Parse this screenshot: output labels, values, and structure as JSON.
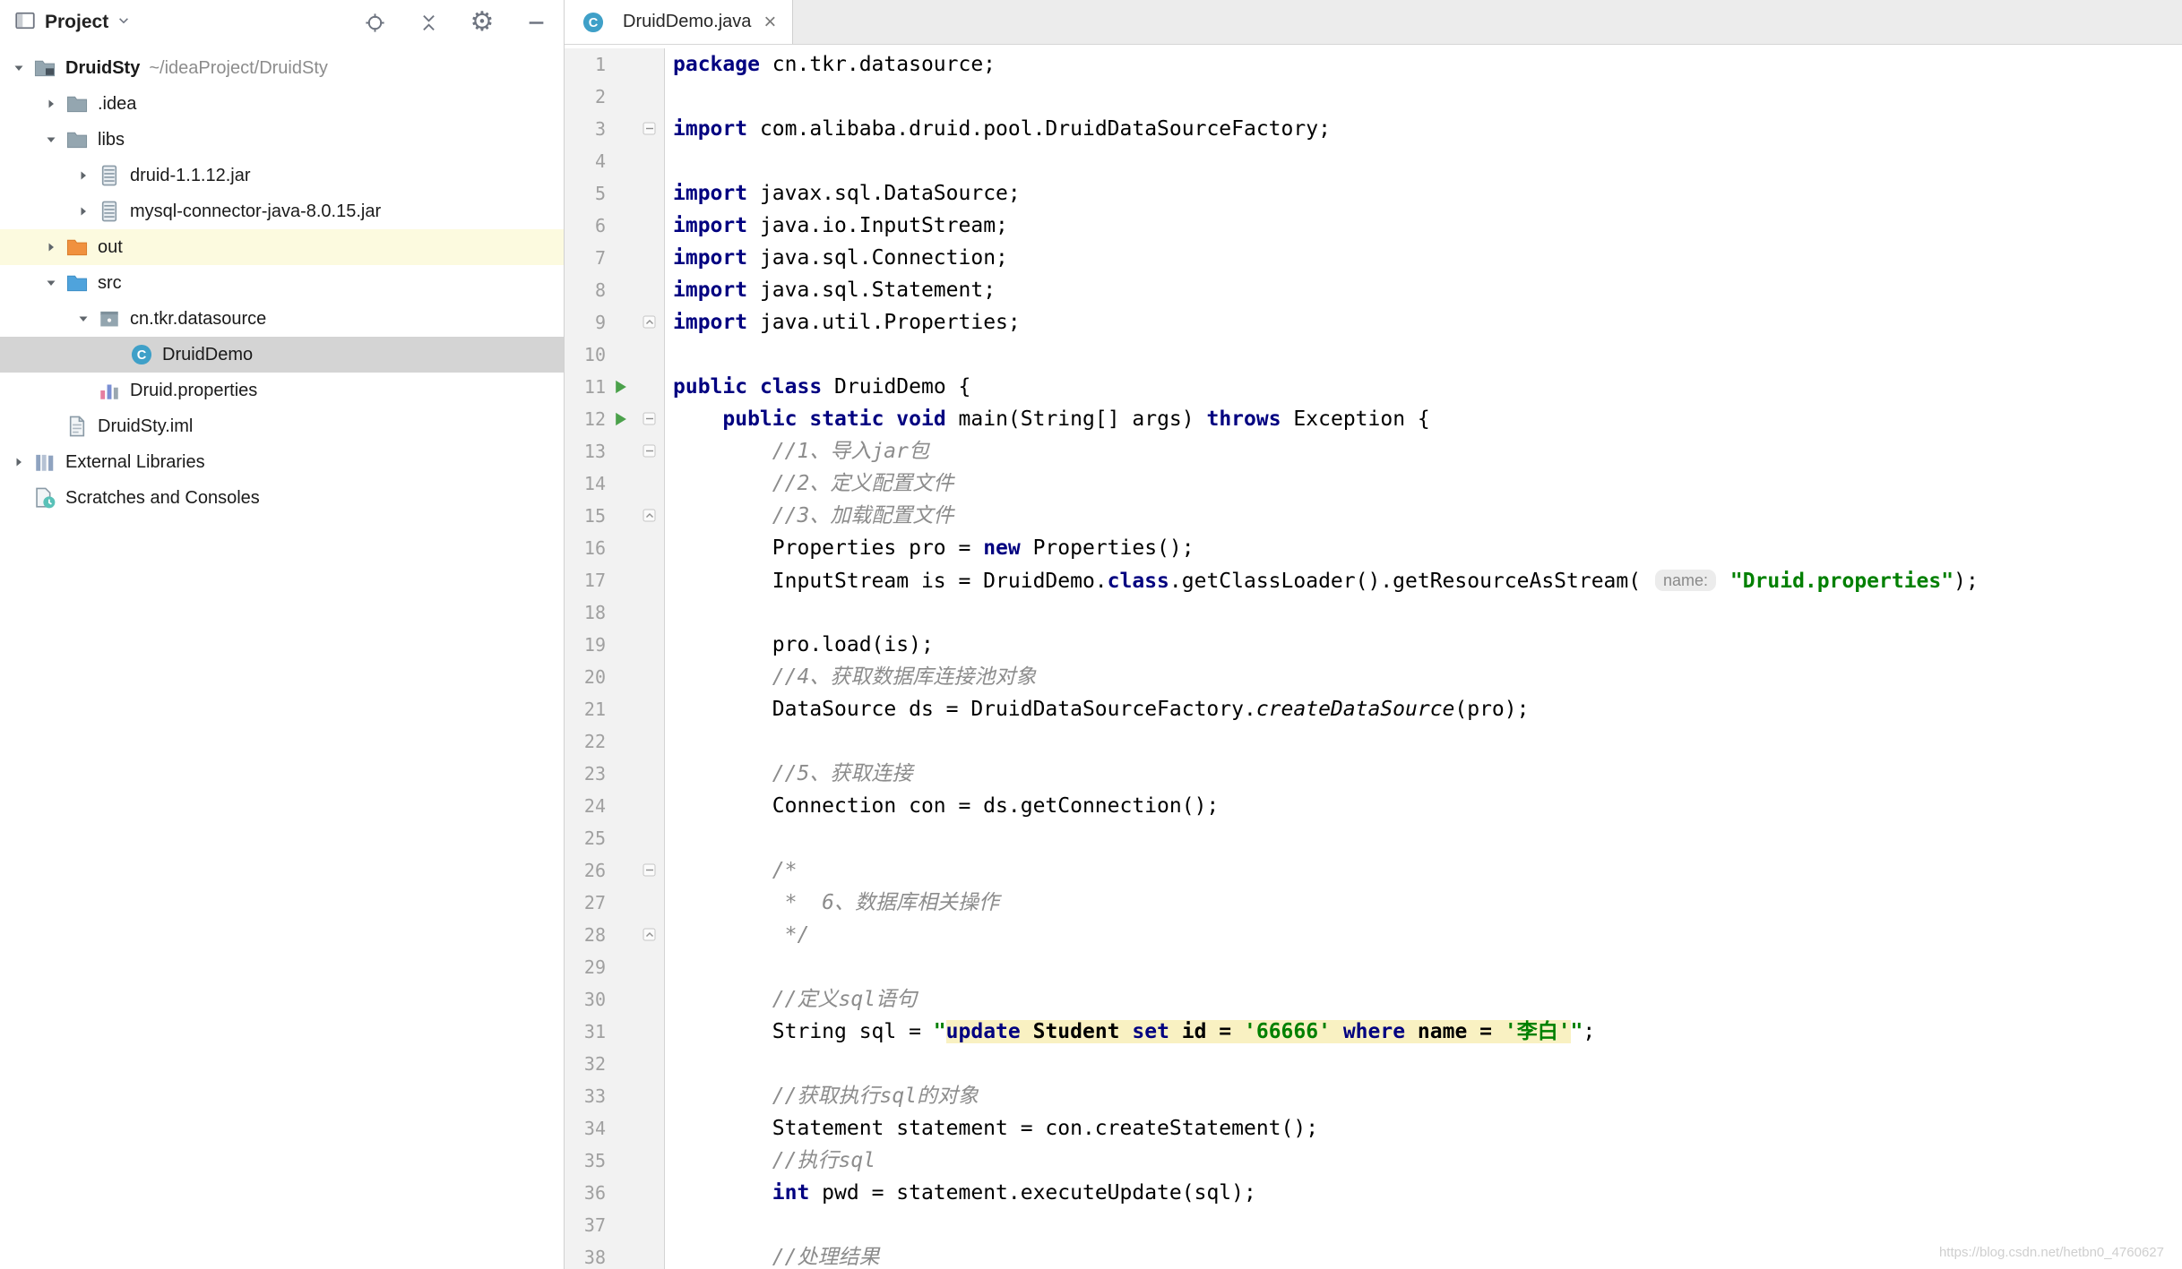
{
  "project_panel": {
    "toolbar": {
      "title": "Project",
      "actions": [
        "locate",
        "collapse-all",
        "settings",
        "hide-panel"
      ]
    },
    "tree": [
      {
        "depth": 0,
        "chevron": "down",
        "icon": "folder-project",
        "label": "DruidSty",
        "extra": "~/ideaProject/DruidSty",
        "bold": true
      },
      {
        "depth": 1,
        "chevron": "right",
        "icon": "folder",
        "label": ".idea"
      },
      {
        "depth": 1,
        "chevron": "down",
        "icon": "folder",
        "label": "libs"
      },
      {
        "depth": 2,
        "chevron": "right",
        "icon": "jar",
        "label": "druid-1.1.12.jar"
      },
      {
        "depth": 2,
        "chevron": "right",
        "icon": "jar",
        "label": "mysql-connector-java-8.0.15.jar"
      },
      {
        "depth": 1,
        "chevron": "right",
        "icon": "folder-excluded",
        "label": "out",
        "highlight": "yellow"
      },
      {
        "depth": 1,
        "chevron": "down",
        "icon": "folder-src",
        "label": "src"
      },
      {
        "depth": 2,
        "chevron": "down",
        "icon": "package",
        "label": "cn.tkr.datasource"
      },
      {
        "depth": 3,
        "chevron": "none",
        "icon": "class",
        "label": "DruidDemo",
        "selected": true
      },
      {
        "depth": 2,
        "chevron": "none",
        "icon": "properties",
        "label": "Druid.properties"
      },
      {
        "depth": 1,
        "chevron": "none",
        "icon": "file-iml",
        "label": "DruidSty.iml"
      },
      {
        "depth": 0,
        "chevron": "right",
        "icon": "libraries",
        "label": "External Libraries"
      },
      {
        "depth": 0,
        "chevron": "none",
        "icon": "scratches",
        "label": "Scratches and Consoles"
      }
    ]
  },
  "editor_tab": {
    "icon": "class",
    "label": "DruidDemo.java",
    "close_glyph": "×"
  },
  "editor": {
    "run_lines": [
      11,
      12
    ],
    "folds": {
      "3": "open",
      "9": "close",
      "12": "open",
      "13": "open",
      "15": "close",
      "26": "open",
      "28": "close"
    },
    "lines": [
      {
        "n": 1,
        "s": [
          [
            "kw",
            "package"
          ],
          [
            "pl",
            " cn.tkr.datasource;"
          ]
        ]
      },
      {
        "n": 2,
        "s": []
      },
      {
        "n": 3,
        "s": [
          [
            "kw",
            "import"
          ],
          [
            "pl",
            " com.alibaba.druid.pool.DruidDataSourceFactory;"
          ]
        ]
      },
      {
        "n": 4,
        "s": []
      },
      {
        "n": 5,
        "s": [
          [
            "kw",
            "import"
          ],
          [
            "pl",
            " javax.sql.DataSource;"
          ]
        ]
      },
      {
        "n": 6,
        "s": [
          [
            "kw",
            "import"
          ],
          [
            "pl",
            " java.io.InputStream;"
          ]
        ]
      },
      {
        "n": 7,
        "s": [
          [
            "kw",
            "import"
          ],
          [
            "pl",
            " java.sql.Connection;"
          ]
        ]
      },
      {
        "n": 8,
        "s": [
          [
            "kw",
            "import"
          ],
          [
            "pl",
            " java.sql.Statement;"
          ]
        ]
      },
      {
        "n": 9,
        "s": [
          [
            "kw",
            "import"
          ],
          [
            "pl",
            " java.util.Properties;"
          ]
        ]
      },
      {
        "n": 10,
        "s": []
      },
      {
        "n": 11,
        "s": [
          [
            "kw",
            "public"
          ],
          [
            "pl",
            " "
          ],
          [
            "kw",
            "class"
          ],
          [
            "pl",
            " DruidDemo {"
          ]
        ]
      },
      {
        "n": 12,
        "s": [
          [
            "pl",
            "    "
          ],
          [
            "kw",
            "public"
          ],
          [
            "pl",
            " "
          ],
          [
            "kw",
            "static"
          ],
          [
            "pl",
            " "
          ],
          [
            "kw",
            "void"
          ],
          [
            "pl",
            " main(String[] args) "
          ],
          [
            "kw",
            "throws"
          ],
          [
            "pl",
            " Exception {"
          ]
        ]
      },
      {
        "n": 13,
        "s": [
          [
            "pl",
            "        "
          ],
          [
            "cm",
            "//1、导入jar包"
          ]
        ]
      },
      {
        "n": 14,
        "s": [
          [
            "pl",
            "        "
          ],
          [
            "cm",
            "//2、定义配置文件"
          ]
        ]
      },
      {
        "n": 15,
        "s": [
          [
            "pl",
            "        "
          ],
          [
            "cm",
            "//3、加载配置文件"
          ]
        ]
      },
      {
        "n": 16,
        "s": [
          [
            "pl",
            "        Properties pro = "
          ],
          [
            "kw",
            "new"
          ],
          [
            "pl",
            " Properties();"
          ]
        ]
      },
      {
        "n": 17,
        "s": [
          [
            "pl",
            "        InputStream is = DruidDemo."
          ],
          [
            "kw",
            "class"
          ],
          [
            "pl",
            ".getClassLoader().getResourceAsStream( "
          ],
          [
            "hint",
            "name:"
          ],
          [
            "pl",
            " "
          ],
          [
            "st",
            "\"Druid.properties\""
          ],
          [
            "pl",
            ");"
          ]
        ]
      },
      {
        "n": 18,
        "s": []
      },
      {
        "n": 19,
        "s": [
          [
            "pl",
            "        pro.load(is);"
          ]
        ]
      },
      {
        "n": 20,
        "s": [
          [
            "pl",
            "        "
          ],
          [
            "cm",
            "//4、获取数据库连接池对象"
          ]
        ]
      },
      {
        "n": 21,
        "s": [
          [
            "pl",
            "        DataSource ds = DruidDataSourceFactory."
          ],
          [
            "sm",
            "createDataSource"
          ],
          [
            "pl",
            "(pro);"
          ]
        ]
      },
      {
        "n": 22,
        "s": []
      },
      {
        "n": 23,
        "s": [
          [
            "pl",
            "        "
          ],
          [
            "cm",
            "//5、获取连接"
          ]
        ]
      },
      {
        "n": 24,
        "s": [
          [
            "pl",
            "        Connection con = ds.getConnection();"
          ]
        ]
      },
      {
        "n": 25,
        "s": []
      },
      {
        "n": 26,
        "s": [
          [
            "pl",
            "        "
          ],
          [
            "cm",
            "/*"
          ]
        ]
      },
      {
        "n": 27,
        "s": [
          [
            "pl",
            "        "
          ],
          [
            "cm",
            " *  6、数据库相关操作"
          ]
        ]
      },
      {
        "n": 28,
        "s": [
          [
            "pl",
            "        "
          ],
          [
            "cm",
            " */"
          ]
        ]
      },
      {
        "n": 29,
        "s": []
      },
      {
        "n": 30,
        "s": [
          [
            "pl",
            "        "
          ],
          [
            "cm",
            "//定义sql语句"
          ]
        ]
      },
      {
        "n": 31,
        "s": [
          [
            "pl",
            "        String sql = "
          ],
          [
            "st",
            "\""
          ],
          [
            "sqlk",
            "update"
          ],
          [
            "sqlp",
            " Student "
          ],
          [
            "sqlk",
            "set"
          ],
          [
            "sqlp",
            " id = "
          ],
          [
            "sqls",
            "'66666'"
          ],
          [
            "sqlp",
            " "
          ],
          [
            "sqlk",
            "where"
          ],
          [
            "sqlp",
            " name = "
          ],
          [
            "sqls",
            "'李白'"
          ],
          [
            "st",
            "\""
          ],
          [
            "pl",
            ";"
          ]
        ]
      },
      {
        "n": 32,
        "s": []
      },
      {
        "n": 33,
        "s": [
          [
            "pl",
            "        "
          ],
          [
            "cm",
            "//获取执行sql的对象"
          ]
        ]
      },
      {
        "n": 34,
        "s": [
          [
            "pl",
            "        Statement statement = con.createStatement();"
          ]
        ]
      },
      {
        "n": 35,
        "s": [
          [
            "pl",
            "        "
          ],
          [
            "cm",
            "//执行sql"
          ]
        ]
      },
      {
        "n": 36,
        "s": [
          [
            "pl",
            "        "
          ],
          [
            "kw",
            "int"
          ],
          [
            "pl",
            " pwd = statement.executeUpdate(sql);"
          ]
        ]
      },
      {
        "n": 37,
        "s": []
      },
      {
        "n": 38,
        "s": [
          [
            "pl",
            "        "
          ],
          [
            "cm",
            "//处理结果"
          ]
        ]
      }
    ]
  },
  "watermark": "https://blog.csdn.net/hetbn0_4760627"
}
